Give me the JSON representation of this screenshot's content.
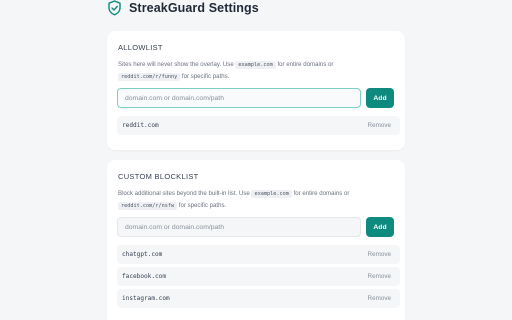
{
  "header": {
    "title": "StreakGuard Settings",
    "icon": "shield-check-icon",
    "accent": "#0f8a7e"
  },
  "allowlist": {
    "title": "ALLOWLIST",
    "desc_before": "Sites here will never show the overlay. Use ",
    "code1": "example.com",
    "desc_middle": " for entire domains or ",
    "code2": "reddit.com/r/funny",
    "desc_after": " for specific paths.",
    "input_placeholder": "domain.com or domain.com/path",
    "input_value": "",
    "add_label": "Add",
    "items": [
      {
        "domain": "reddit.com",
        "remove_label": "Remove"
      }
    ]
  },
  "blocklist": {
    "title": "CUSTOM BLOCKLIST",
    "desc_before": "Block additional sites beyond the built-in list. Use ",
    "code1": "example.com",
    "desc_middle": " for entire domains or ",
    "code2": "reddit.com/r/nsfw",
    "desc_after": " for specific paths.",
    "input_placeholder": "domain.com or domain.com/path",
    "input_value": "",
    "add_label": "Add",
    "items": [
      {
        "domain": "chatgpt.com",
        "remove_label": "Remove"
      },
      {
        "domain": "facebook.com",
        "remove_label": "Remove"
      },
      {
        "domain": "instagram.com",
        "remove_label": "Remove"
      }
    ]
  }
}
